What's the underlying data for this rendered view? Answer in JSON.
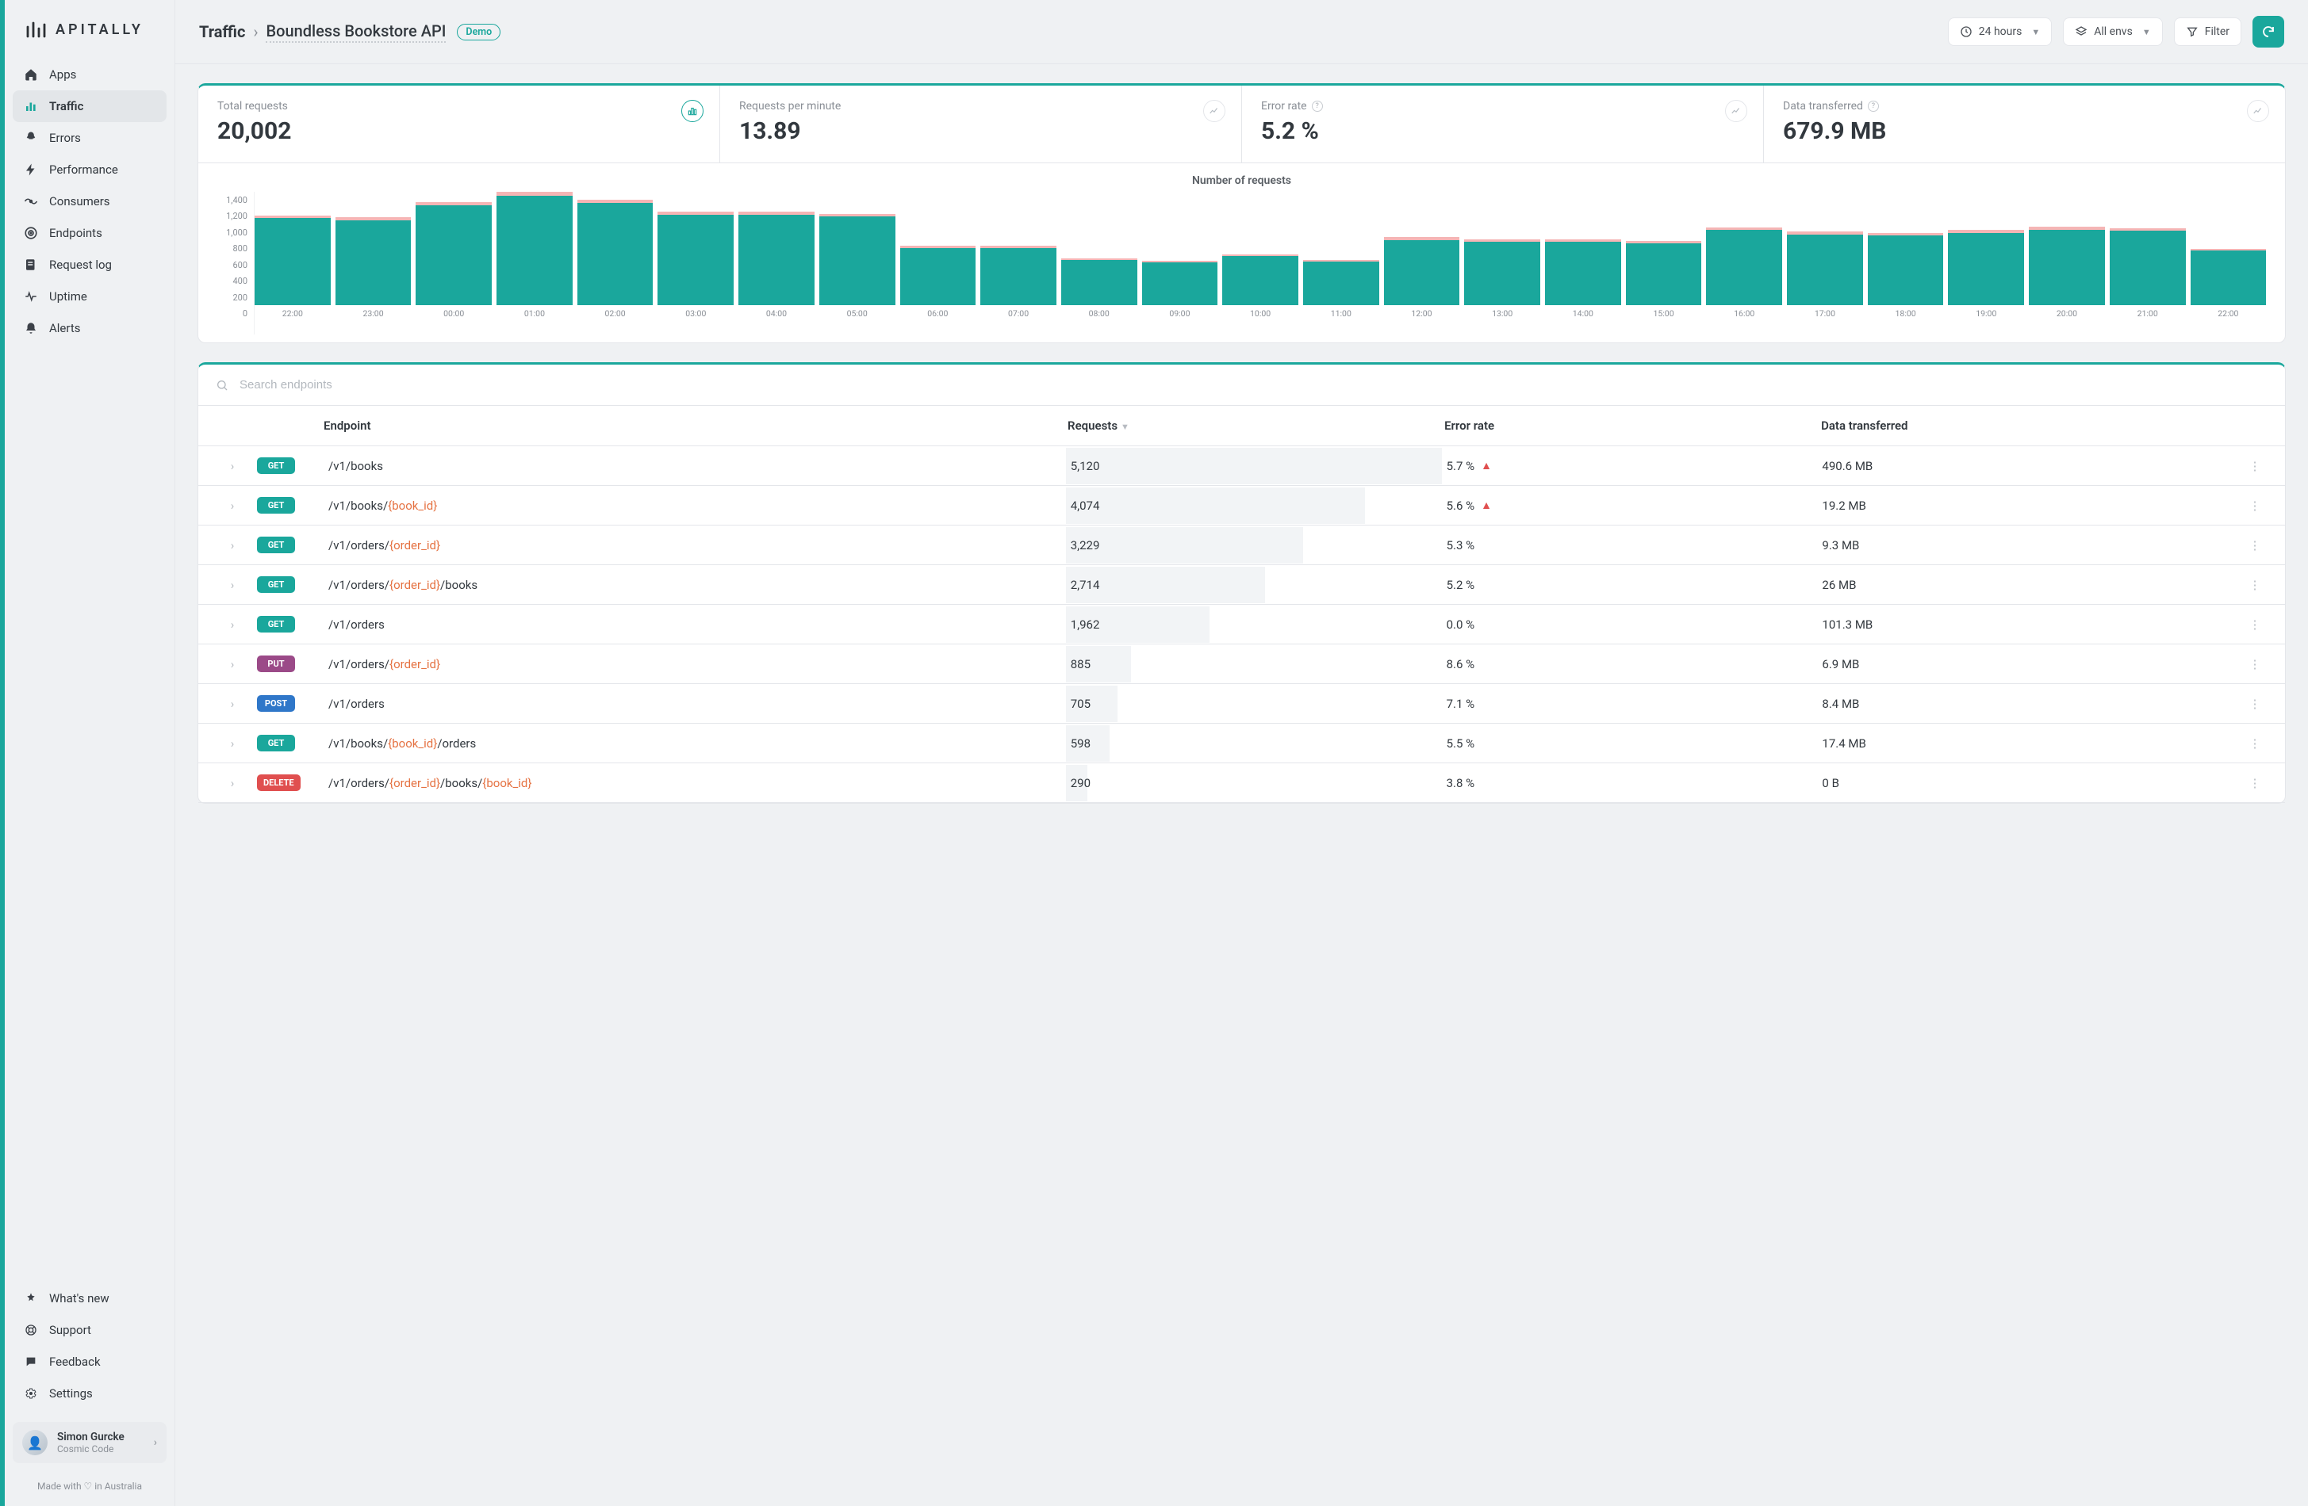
{
  "brand": "APITALLY",
  "sidebar": {
    "items": [
      {
        "label": "Apps",
        "active": false
      },
      {
        "label": "Traffic",
        "active": true
      },
      {
        "label": "Errors",
        "active": false
      },
      {
        "label": "Performance",
        "active": false
      },
      {
        "label": "Consumers",
        "active": false
      },
      {
        "label": "Endpoints",
        "active": false
      },
      {
        "label": "Request log",
        "active": false
      },
      {
        "label": "Uptime",
        "active": false
      },
      {
        "label": "Alerts",
        "active": false
      }
    ],
    "bottom": [
      {
        "label": "What's new"
      },
      {
        "label": "Support"
      },
      {
        "label": "Feedback"
      },
      {
        "label": "Settings"
      }
    ],
    "user": {
      "name": "Simon Gurcke",
      "org": "Cosmic Code"
    },
    "footer": "Made with ♡ in Australia"
  },
  "header": {
    "crumb_root": "Traffic",
    "crumb_leaf": "Boundless Bookstore API",
    "badge": "Demo",
    "time_range": "24 hours",
    "env": "All envs",
    "filter": "Filter"
  },
  "metrics": [
    {
      "label": "Total requests",
      "value": "20,002",
      "help": false
    },
    {
      "label": "Requests per minute",
      "value": "13.89",
      "help": false
    },
    {
      "label": "Error rate",
      "value": "5.2 %",
      "help": true
    },
    {
      "label": "Data transferred",
      "value": "679.9 MB",
      "help": true
    }
  ],
  "chart_data": {
    "type": "bar",
    "title": "Number of requests",
    "xlabel": "",
    "ylabel": "",
    "ylim": [
      0,
      1400
    ],
    "yticks": [
      0,
      200,
      400,
      600,
      800,
      1000,
      1200,
      1400
    ],
    "categories": [
      "22:00",
      "23:00",
      "00:00",
      "01:00",
      "02:00",
      "03:00",
      "04:00",
      "05:00",
      "06:00",
      "07:00",
      "08:00",
      "09:00",
      "10:00",
      "11:00",
      "12:00",
      "13:00",
      "14:00",
      "15:00",
      "16:00",
      "17:00",
      "18:00",
      "19:00",
      "20:00",
      "21:00",
      "22:00"
    ],
    "series": [
      {
        "name": "successful",
        "color": "#1aa79c",
        "values": [
          960,
          940,
          1100,
          1210,
          1130,
          1000,
          1000,
          980,
          630,
          630,
          500,
          470,
          540,
          480,
          720,
          700,
          700,
          680,
          830,
          780,
          770,
          800,
          830,
          820,
          600
        ]
      },
      {
        "name": "errors",
        "color": "#f5b5b5",
        "values": [
          30,
          30,
          35,
          40,
          35,
          30,
          30,
          30,
          25,
          25,
          20,
          20,
          20,
          20,
          30,
          25,
          25,
          25,
          30,
          30,
          30,
          30,
          35,
          30,
          20
        ]
      }
    ]
  },
  "endpoints": {
    "search_placeholder": "Search endpoints",
    "columns": {
      "endpoint": "Endpoint",
      "requests": "Requests",
      "error_rate": "Error rate",
      "data": "Data transferred"
    },
    "max_requests": 5120,
    "rows": [
      {
        "method": "GET",
        "path": [
          [
            "",
            "/v1/books"
          ]
        ],
        "requests": "5,120",
        "req_n": 5120,
        "error_rate": "5.7 %",
        "warn": true,
        "data": "490.6 MB"
      },
      {
        "method": "GET",
        "path": [
          [
            "",
            "/v1/books/"
          ],
          [
            "p",
            "{book_id}"
          ]
        ],
        "requests": "4,074",
        "req_n": 4074,
        "error_rate": "5.6 %",
        "warn": true,
        "data": "19.2 MB"
      },
      {
        "method": "GET",
        "path": [
          [
            "",
            "/v1/orders/"
          ],
          [
            "p",
            "{order_id}"
          ]
        ],
        "requests": "3,229",
        "req_n": 3229,
        "error_rate": "5.3 %",
        "warn": false,
        "data": "9.3 MB"
      },
      {
        "method": "GET",
        "path": [
          [
            "",
            "/v1/orders/"
          ],
          [
            "p",
            "{order_id}"
          ],
          [
            "",
            "/books"
          ]
        ],
        "requests": "2,714",
        "req_n": 2714,
        "error_rate": "5.2 %",
        "warn": false,
        "data": "26 MB"
      },
      {
        "method": "GET",
        "path": [
          [
            "",
            "/v1/orders"
          ]
        ],
        "requests": "1,962",
        "req_n": 1962,
        "error_rate": "0.0 %",
        "warn": false,
        "data": "101.3 MB"
      },
      {
        "method": "PUT",
        "path": [
          [
            "",
            "/v1/orders/"
          ],
          [
            "p",
            "{order_id}"
          ]
        ],
        "requests": "885",
        "req_n": 885,
        "error_rate": "8.6 %",
        "warn": false,
        "data": "6.9 MB"
      },
      {
        "method": "POST",
        "path": [
          [
            "",
            "/v1/orders"
          ]
        ],
        "requests": "705",
        "req_n": 705,
        "error_rate": "7.1 %",
        "warn": false,
        "data": "8.4 MB"
      },
      {
        "method": "GET",
        "path": [
          [
            "",
            "/v1/books/"
          ],
          [
            "p",
            "{book_id}"
          ],
          [
            "",
            "/orders"
          ]
        ],
        "requests": "598",
        "req_n": 598,
        "error_rate": "5.5 %",
        "warn": false,
        "data": "17.4 MB"
      },
      {
        "method": "DELETE",
        "path": [
          [
            "",
            "/v1/orders/"
          ],
          [
            "p",
            "{order_id}"
          ],
          [
            "",
            "/books/"
          ],
          [
            "p",
            "{book_id}"
          ]
        ],
        "requests": "290",
        "req_n": 290,
        "error_rate": "3.8 %",
        "warn": false,
        "data": "0 B"
      }
    ]
  }
}
